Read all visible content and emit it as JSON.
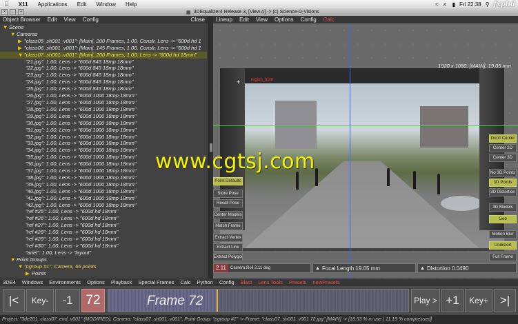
{
  "macbar": {
    "apple": "",
    "app": "X11",
    "menus": [
      "Applications",
      "Edit",
      "Window",
      "Help"
    ],
    "clock": "Fri 22:38",
    "watermark": "fxphd"
  },
  "window": {
    "title": "3DEqualizer4 Release 3, [View A]  -> (c) Science-D-Visions"
  },
  "object_browser": {
    "menu": [
      "Object Browser",
      "Edit",
      "View",
      "Config"
    ],
    "close": "Close",
    "tree": [
      {
        "tri": "▼",
        "text": "Scene",
        "indent": 0,
        "kind": "normal"
      },
      {
        "tri": "▼",
        "text": "Cameras",
        "indent": 1,
        "kind": "normal"
      },
      {
        "tri": "▶",
        "text": "\"class05_sh001_v001\": [Main], 200 Frames, 1.00, Constr, Lens -> \"600d hd 1",
        "indent": 2,
        "kind": "normal"
      },
      {
        "tri": "▶",
        "text": "\"class06_sh001_v001\": [Main], 145 Frames, 1.00, Constr, Lens -> \"600d hd 1",
        "indent": 2,
        "kind": "normal"
      },
      {
        "tri": "▼",
        "text": "\"class07_sh001_v001\": [Main], 200 Frames, 1.00, Lens -> \"600d hd 18mm\"",
        "indent": 2,
        "kind": "sel"
      },
      {
        "tri": "",
        "text": "\"21.jpg\": 1.00, Lens -> \"600d 843 18mp 18mm\"",
        "indent": 3,
        "kind": "normal"
      },
      {
        "tri": "",
        "text": "\"22.jpg\": 1.00, Lens -> \"600d 843 18mp 18mm\"",
        "indent": 3,
        "kind": "normal"
      },
      {
        "tri": "",
        "text": "\"23.jpg\": 1.00, Lens -> \"600d 843 18mp 18mm\"",
        "indent": 3,
        "kind": "normal"
      },
      {
        "tri": "",
        "text": "\"24.jpg\": 1.00, Lens -> \"600d 843 18mp 18mm\"",
        "indent": 3,
        "kind": "normal"
      },
      {
        "tri": "",
        "text": "\"25.jpg\": 1.00, Lens -> \"600d 843 18mp 18mm\"",
        "indent": 3,
        "kind": "normal"
      },
      {
        "tri": "",
        "text": "\"26.jpg\": 1.00, Lens -> \"600d 1000 18mp 18mm\"",
        "indent": 3,
        "kind": "normal"
      },
      {
        "tri": "",
        "text": "\"27.jpg\": 1.00, Lens -> \"600d 1000 18mp 18mm\"",
        "indent": 3,
        "kind": "normal"
      },
      {
        "tri": "",
        "text": "\"28.jpg\": 1.00, Lens -> \"600d 1000 18mp 18mm\"",
        "indent": 3,
        "kind": "normal"
      },
      {
        "tri": "",
        "text": "\"29.jpg\": 1.00, Lens -> \"600d 1000 18mp 18mm\"",
        "indent": 3,
        "kind": "normal"
      },
      {
        "tri": "",
        "text": "\"30.jpg\": 1.00, Lens -> \"600d 1000 18mp 18mm\"",
        "indent": 3,
        "kind": "normal"
      },
      {
        "tri": "",
        "text": "\"31.jpg\": 1.00, Lens -> \"600d 1000 18mp 18mm\"",
        "indent": 3,
        "kind": "normal"
      },
      {
        "tri": "",
        "text": "\"32.jpg\": 1.00, Lens -> \"600d 1000 18mp 18mm\"",
        "indent": 3,
        "kind": "normal"
      },
      {
        "tri": "",
        "text": "\"33.jpg\": 1.00, Lens -> \"600d 1000 18mp 18mm\"",
        "indent": 3,
        "kind": "normal"
      },
      {
        "tri": "",
        "text": "\"34.jpg\": 1.00, Lens -> \"600d 1000 18mp 18mm\"",
        "indent": 3,
        "kind": "normal"
      },
      {
        "tri": "",
        "text": "\"35.jpg\": 1.00, Lens -> \"600d 1000 18mp 18mm\"",
        "indent": 3,
        "kind": "normal"
      },
      {
        "tri": "",
        "text": "\"36.jpg\": 1.00, Lens -> \"600d 1000 18mp 18mm\"",
        "indent": 3,
        "kind": "normal"
      },
      {
        "tri": "",
        "text": "\"37.jpg\": 1.00, Lens -> \"600d 1000 18mp 18mm\"",
        "indent": 3,
        "kind": "normal"
      },
      {
        "tri": "",
        "text": "\"38.jpg\": 1.00, Lens -> \"600d 1000 18mp 18mm\"",
        "indent": 3,
        "kind": "normal"
      },
      {
        "tri": "",
        "text": "\"39.jpg\": 1.00, Lens -> \"600d 1000 18mp 18mm\"",
        "indent": 3,
        "kind": "normal"
      },
      {
        "tri": "",
        "text": "\"40.jpg\": 1.00, Lens -> \"600d 1000 18mp 18mm\"",
        "indent": 3,
        "kind": "normal"
      },
      {
        "tri": "",
        "text": "\"41.jpg\": 1.00, Lens -> \"600d 1000 18mp 18mm\"",
        "indent": 3,
        "kind": "normal"
      },
      {
        "tri": "",
        "text": "\"42.jpg\": 1.00, Lens -> \"600d 1000 18mp 18mm\"",
        "indent": 3,
        "kind": "normal"
      },
      {
        "tri": "",
        "text": "\"ref #25\": 1.00, Lens -> \"600d hd 18mm\"",
        "indent": 3,
        "kind": "normal"
      },
      {
        "tri": "",
        "text": "\"ref #26\": 1.00, Lens -> \"600d hd 18mm\"",
        "indent": 3,
        "kind": "normal"
      },
      {
        "tri": "",
        "text": "\"ref #27\": 1.00, Lens -> \"600d hd 18mm\"",
        "indent": 3,
        "kind": "normal"
      },
      {
        "tri": "",
        "text": "\"ref #28\": 1.00, Lens -> \"600d hd 18mm\"",
        "indent": 3,
        "kind": "normal"
      },
      {
        "tri": "",
        "text": "\"ref #29\": 1.00, Lens -> \"600d hd 18mm\"",
        "indent": 3,
        "kind": "normal"
      },
      {
        "tri": "",
        "text": "\"ref #30\": 1.00, Lens -> \"600d hd 18mm\"",
        "indent": 3,
        "kind": "normal"
      },
      {
        "tri": "",
        "text": "\"ariel\": 1.00, Lens -> \"layout\"",
        "indent": 3,
        "kind": "normal"
      },
      {
        "tri": "▼",
        "text": "Point Groups",
        "indent": 1,
        "kind": "normal"
      },
      {
        "tri": "▼",
        "text": "\"pgroup #1\": Camera, 66 points",
        "indent": 2,
        "kind": "yellow"
      },
      {
        "tri": "▶",
        "text": "Points",
        "indent": 3,
        "kind": "normal"
      }
    ]
  },
  "lineup": {
    "menu": [
      "Lineup",
      "Edit",
      "View",
      "Options",
      "Config"
    ],
    "calc": "Calc",
    "resolution_info": "1920 x 1080, [MAIN], 19.05 mm",
    "red_label": "region_front",
    "left_buttons": [
      "Point Defaults",
      "Store Pose",
      "Recall Pose",
      "Center Models",
      "Match Frame",
      "Extract Vertex",
      "Extract Line",
      "Extract Polygon"
    ],
    "right_buttons": [
      "Don't Center",
      "Center 2D",
      "Center 3D",
      "No 3D Points",
      "3D Points",
      "3D Distortion",
      "3D Models",
      "Geo",
      "Motion Blur",
      "Undistort",
      "Full Frame"
    ],
    "right_highlight": [
      "Don't Center",
      "3D Points",
      "Geo",
      "Undistort"
    ],
    "params": {
      "camera_roll_value": "2.11",
      "camera_roll_label": "Camera Roll 2.11 deg",
      "focal_length": "Focal Length 19.05 mm",
      "distortion": "Distortion 0.0490"
    }
  },
  "overlay_watermark": "www.cgtsj.com",
  "bottom_menu": {
    "items": [
      "3DE4",
      "Windows",
      "Environments",
      "Options",
      "Playback",
      "Special Frames",
      "Calc",
      "Python",
      "Config"
    ],
    "red_items": [
      "Blast",
      "Lens Tools",
      "Presets",
      "newPresets"
    ]
  },
  "timeline": {
    "first_frame": "|<",
    "key_minus": "Key-",
    "minus_one": "-1",
    "frame_number": "72",
    "frame_label": "Frame 72",
    "play": "Play >",
    "plus_one": "+1",
    "key_plus": "Key+",
    "last_frame": ">|",
    "progress_fraction": 0.36
  },
  "status": {
    "text": "Project: \"3de201_class07_end_v001\" (MODIFIED), Camera: \"class07_sh001_v001\", Point Group: \"pgroup #1\" -> Frame: \"class07_sh001_v001 72.jpg\" [MAIN] -> [18.53 % in use | 11.19 % compressed]"
  },
  "colors": {
    "highlight_button": "#b8bd50",
    "menu_red": "#e85050",
    "frame_box": "#b06a6a",
    "horizon_line": "#4cd640",
    "vertical_line": "#4060ff",
    "watermark_yellow": "#f2f200"
  }
}
